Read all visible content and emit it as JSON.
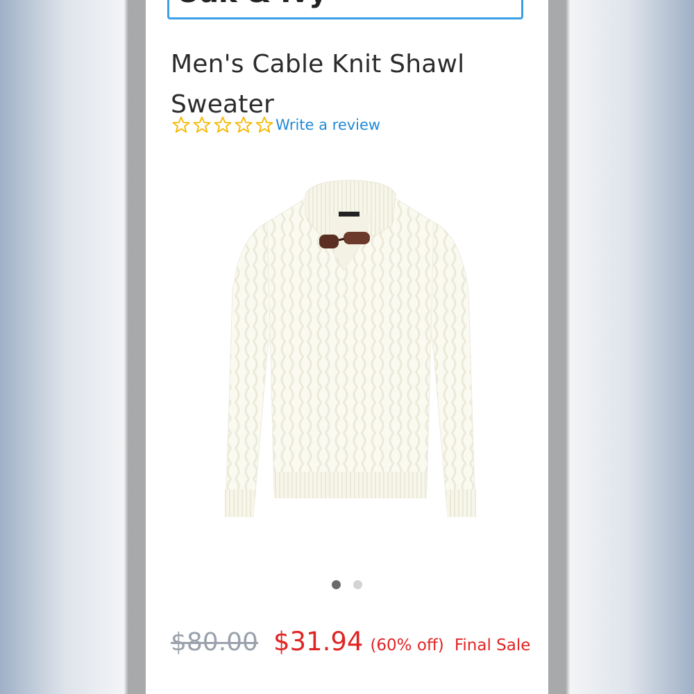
{
  "brand": {
    "name": "Oak & Ivy"
  },
  "product": {
    "title": "Men's Cable Knit Shawl Sweater",
    "rating_stars": 0,
    "rating_max": 5,
    "review_link": "Write a review",
    "image_alt": "White cable knit shawl collar sweater with toggle button",
    "gallery": {
      "count": 2,
      "active_index": 0
    }
  },
  "pricing": {
    "original": "$80.00",
    "sale": "$31.94",
    "discount": "(60% off)",
    "note": "Final Sale"
  },
  "colors": {
    "accent_blue": "#1f8ad6",
    "sale_red": "#e02424",
    "star_gold": "#f5b800",
    "frame_blue": "#3aa0e6"
  }
}
